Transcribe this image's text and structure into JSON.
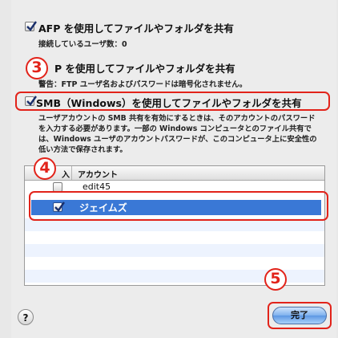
{
  "afp": {
    "label": "AFP を使用してファイルやフォルダを共有",
    "checked": true,
    "connected_users": "接続しているユーザ数：0"
  },
  "ftp": {
    "label": "P を使用してファイルやフォルダを共有",
    "warning": "警告：FTP ユーザ名およびパスワードは暗号化されません。"
  },
  "smb": {
    "label": "SMB（Windows）を使用してファイルやフォルダを共有",
    "checked": true,
    "description": "ユーザアカウントの SMB 共有を有効にするときは、そのアカウントのパスワードを入力する必要があります。一部の Windows コンピュータとのファイル共有では、Windows ユーザのアカウントパスワードが、このコンピュータ上に安全性の低い方法で保存されます。"
  },
  "table": {
    "col_on": "入",
    "col_account": "アカウント",
    "rows": [
      {
        "account": "edit45",
        "checked": false
      },
      {
        "account": "ジェイムズ",
        "checked": true,
        "selected": true
      }
    ]
  },
  "steps": {
    "step3": "3",
    "step4": "4",
    "step5": "5"
  },
  "buttons": {
    "help": "?",
    "done": "完了"
  },
  "colors": {
    "annotation_red": "#e2231a",
    "selection_blue": "#3a78d6",
    "checkbox_check": "#1a2f6b"
  }
}
